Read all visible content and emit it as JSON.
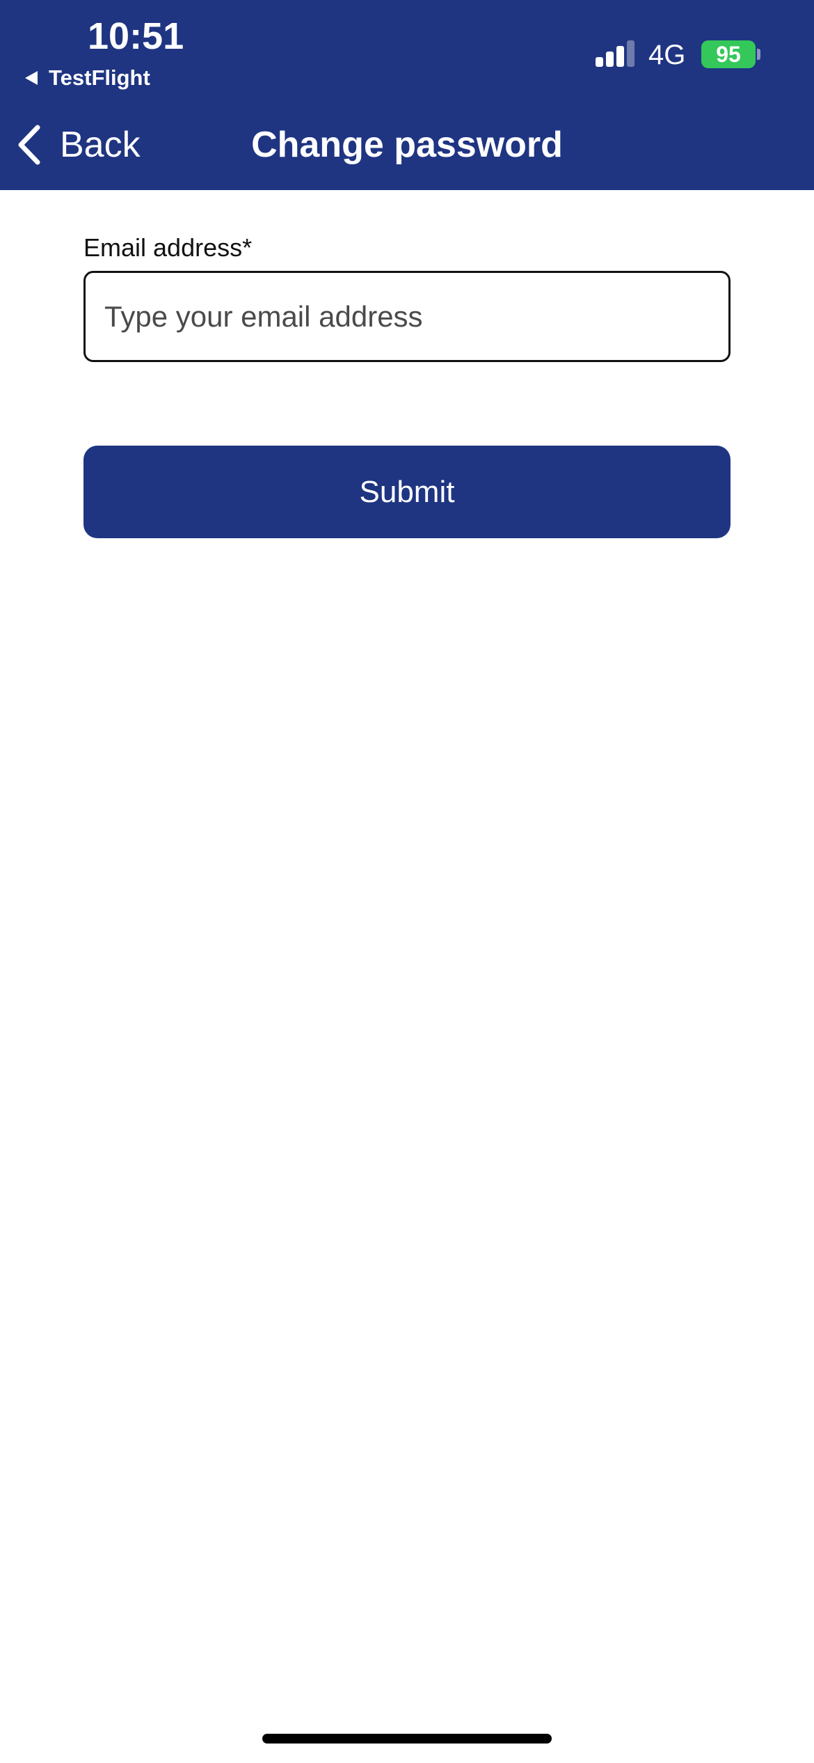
{
  "status_bar": {
    "time": "10:51",
    "back_app_label": "TestFlight",
    "network": "4G",
    "battery_level": "95",
    "signal_bars_active": 3,
    "signal_bars_total": 4
  },
  "nav_bar": {
    "back_label": "Back",
    "title": "Change password"
  },
  "form": {
    "email_label": "Email address*",
    "email_value": "",
    "email_placeholder": "Type your email address",
    "submit_label": "Submit"
  },
  "colors": {
    "brand": "#1f3582",
    "battery": "#34c759",
    "background": "#ffffff"
  }
}
